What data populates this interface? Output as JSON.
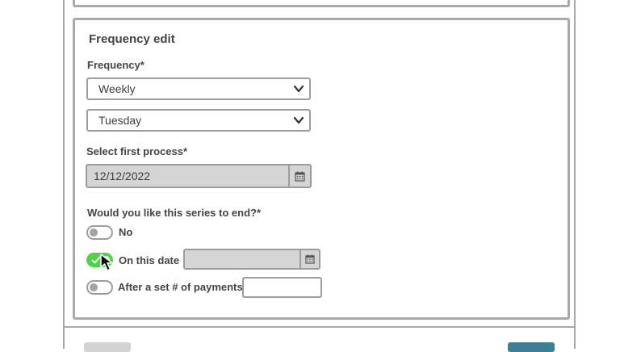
{
  "frequency_edit": {
    "title": "Frequency edit",
    "frequency_label": "Frequency*",
    "frequency_value": "Weekly",
    "day_value": "Tuesday",
    "first_process_label": "Select first process*",
    "first_process_value": "12/12/2022",
    "end_question": "Would you like this series to end?*",
    "options": [
      {
        "label": "No",
        "on": false
      },
      {
        "label": "On this date",
        "on": true,
        "date_value": ""
      },
      {
        "label": "After a set # of payments",
        "on": false,
        "count_value": ""
      }
    ]
  },
  "icons": {
    "dropdown": "chevron-down-icon",
    "calendar": "calendar-icon",
    "toggle_check": "check-icon",
    "cursor": "mouse-pointer-icon"
  },
  "colors": {
    "toggle_on": "#54d14a",
    "border": "#9c9c9c",
    "disabled_fill": "#d5d5d5",
    "primary_button": "#3f7f94"
  }
}
